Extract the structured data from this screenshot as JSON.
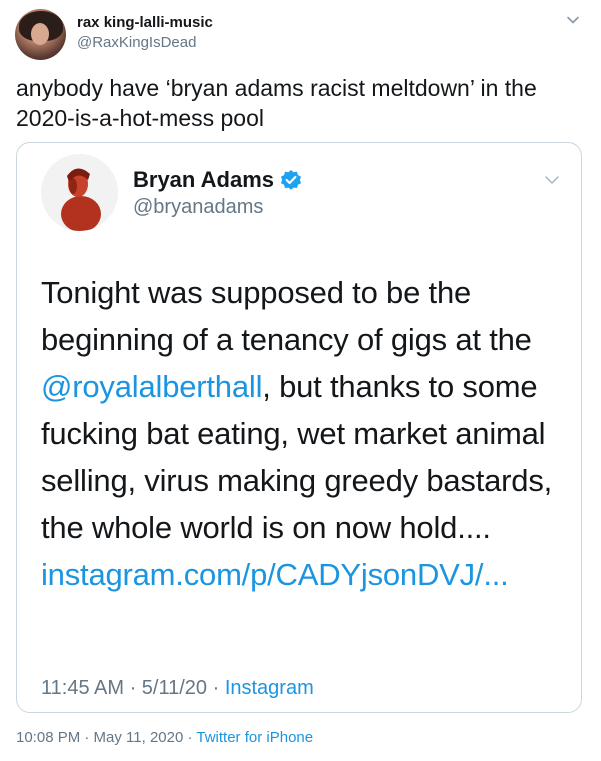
{
  "tweet": {
    "author_name": "rax king-lalli-music",
    "author_handle": "@RaxKingIsDead",
    "text": "anybody have ‘bryan adams racist meltdown’ in the 2020-is-a-hot-mess pool",
    "timestamp": "10:08 PM · May 11, 2020 · ",
    "source": "Twitter for iPhone"
  },
  "quote": {
    "author_name": "Bryan Adams",
    "author_handle": "@bryanadams",
    "text_1": "Tonight was supposed to be the beginning of a tenancy of gigs at the ",
    "mention": "@royalalberthall",
    "text_2": ", but thanks to some fucking bat eating, wet market animal selling, virus making greedy bastards, the whole world is on now hold.... ",
    "link": "instagram.com/p/CADYjsonDVJ/...",
    "timestamp": "11:45 AM · 5/11/20 · ",
    "source": "Instagram"
  },
  "icons": {
    "caret": "chevron-down-icon",
    "verified": "verified-badge-icon"
  },
  "colors": {
    "link": "#1b95e0",
    "secondary_text": "#657786",
    "border": "#ccd6dd",
    "verified": "#1da1f2"
  }
}
